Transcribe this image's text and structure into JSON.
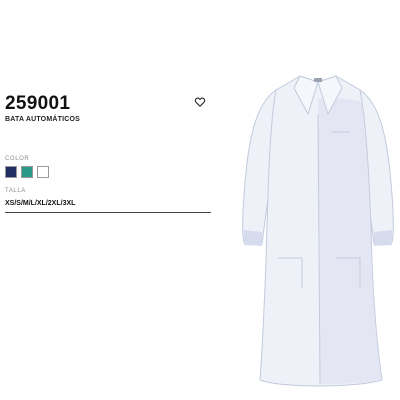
{
  "product": {
    "code": "259001",
    "name": "BATA AUTOMÁTICOS"
  },
  "wishlist": {
    "icon": "heart-outline-icon"
  },
  "color_section": {
    "label": "COLOR",
    "swatches": [
      {
        "name": "navy",
        "color": "#1f2f63"
      },
      {
        "name": "green",
        "color": "#2a9a86"
      },
      {
        "name": "white",
        "color": "#ffffff"
      }
    ]
  },
  "size_section": {
    "label": "TALLA",
    "sizes": "XS/S/M/L/XL/2XL/3XL"
  },
  "colors": {
    "garment_fill": "#eef1f8",
    "garment_shadow": "#d6dced",
    "garment_outline": "#c3cadc"
  }
}
